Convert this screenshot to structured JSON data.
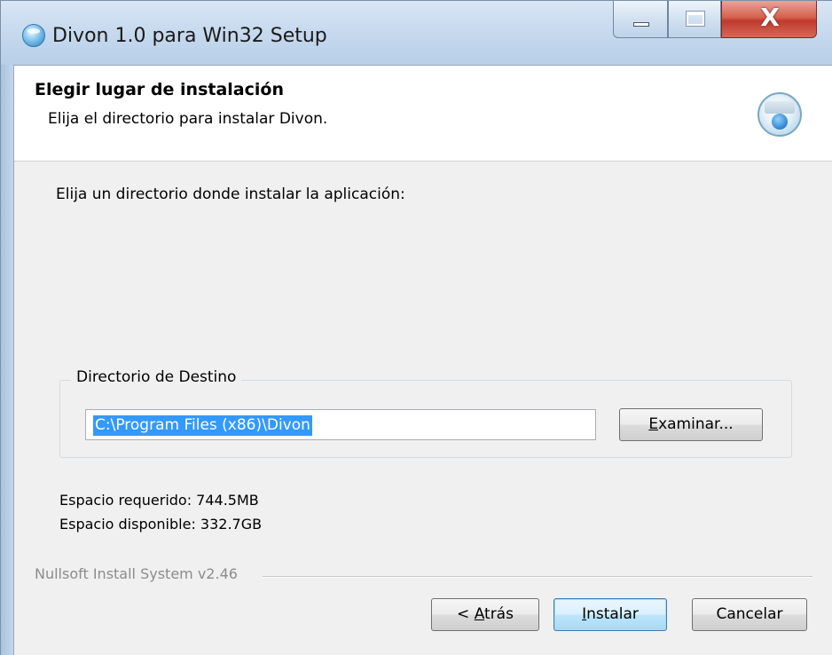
{
  "window": {
    "title": "Divon 1.0 para Win32 Setup",
    "close_glyph": "X",
    "accent_color": "#3399ff",
    "icons": [
      "installer-app-icon",
      "minimize-icon",
      "maximize-icon",
      "close-icon",
      "installer-globe-icon"
    ]
  },
  "header": {
    "title": "Elegir lugar de instalación",
    "subtitle": "Elija el directorio para instalar Divon."
  },
  "body": {
    "prompt": "Elija un directorio donde instalar la aplicación:",
    "destination_group_label": "Directorio de Destino",
    "destination_path": "C:\\Program Files (x86)\\Divon",
    "browse_button": {
      "accel": "E",
      "rest": "xaminar..."
    },
    "space_required": "Espacio requerido: 744.5MB",
    "space_available": "Espacio disponible: 332.7GB"
  },
  "footer": {
    "branding": "Nullsoft Install System v2.46",
    "back_button": {
      "prefix": "< ",
      "accel": "A",
      "rest": "trás"
    },
    "install_button": {
      "accel": "I",
      "rest": "nstalar"
    },
    "cancel_button": "Cancelar"
  }
}
